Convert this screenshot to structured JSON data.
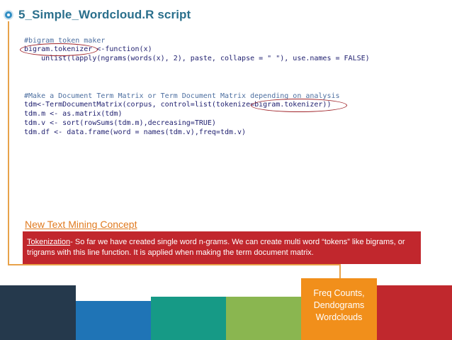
{
  "header": {
    "title": "5_Simple_Wordcloud.R script"
  },
  "code": {
    "lines": [
      "#bigram token maker",
      "bigram.tokenizer <-function(x)",
      "    unlist(lapply(ngrams(words(x), 2), paste, collapse = \" \"), use.names = FALSE)",
      "",
      "",
      "",
      "#Make a Document Term Matrix or Term Document Matrix depending on analysis",
      "tdm<-TermDocumentMatrix(corpus, control=list(tokenize=bigram.tokenizer))",
      "tdm.m <- as.matrix(tdm)",
      "tdm.v <- sort(rowSums(tdm.m),decreasing=TRUE)",
      "tdm.df <- data.frame(word = names(tdm.v),freq=tdm.v)"
    ]
  },
  "concept": {
    "title": "New Text Mining Concept",
    "term": "Tokenization",
    "body": "- So far we have created single word n-grams.  We can create multi word “tokens” like bigrams, or trigrams with this line function.  It is applied when making the term document matrix."
  },
  "footer": {
    "lines": [
      "Freq Counts,",
      "Dendograms",
      "Wordclouds"
    ]
  },
  "colors": {
    "accent_orange": "#f18f1b",
    "accent_red": "#c1272d",
    "title_teal": "#2a6f8c",
    "band": [
      "#25394c",
      "#1f74b6",
      "#169a86",
      "#8ab650",
      "#f18f1b",
      "#c0282d"
    ]
  }
}
